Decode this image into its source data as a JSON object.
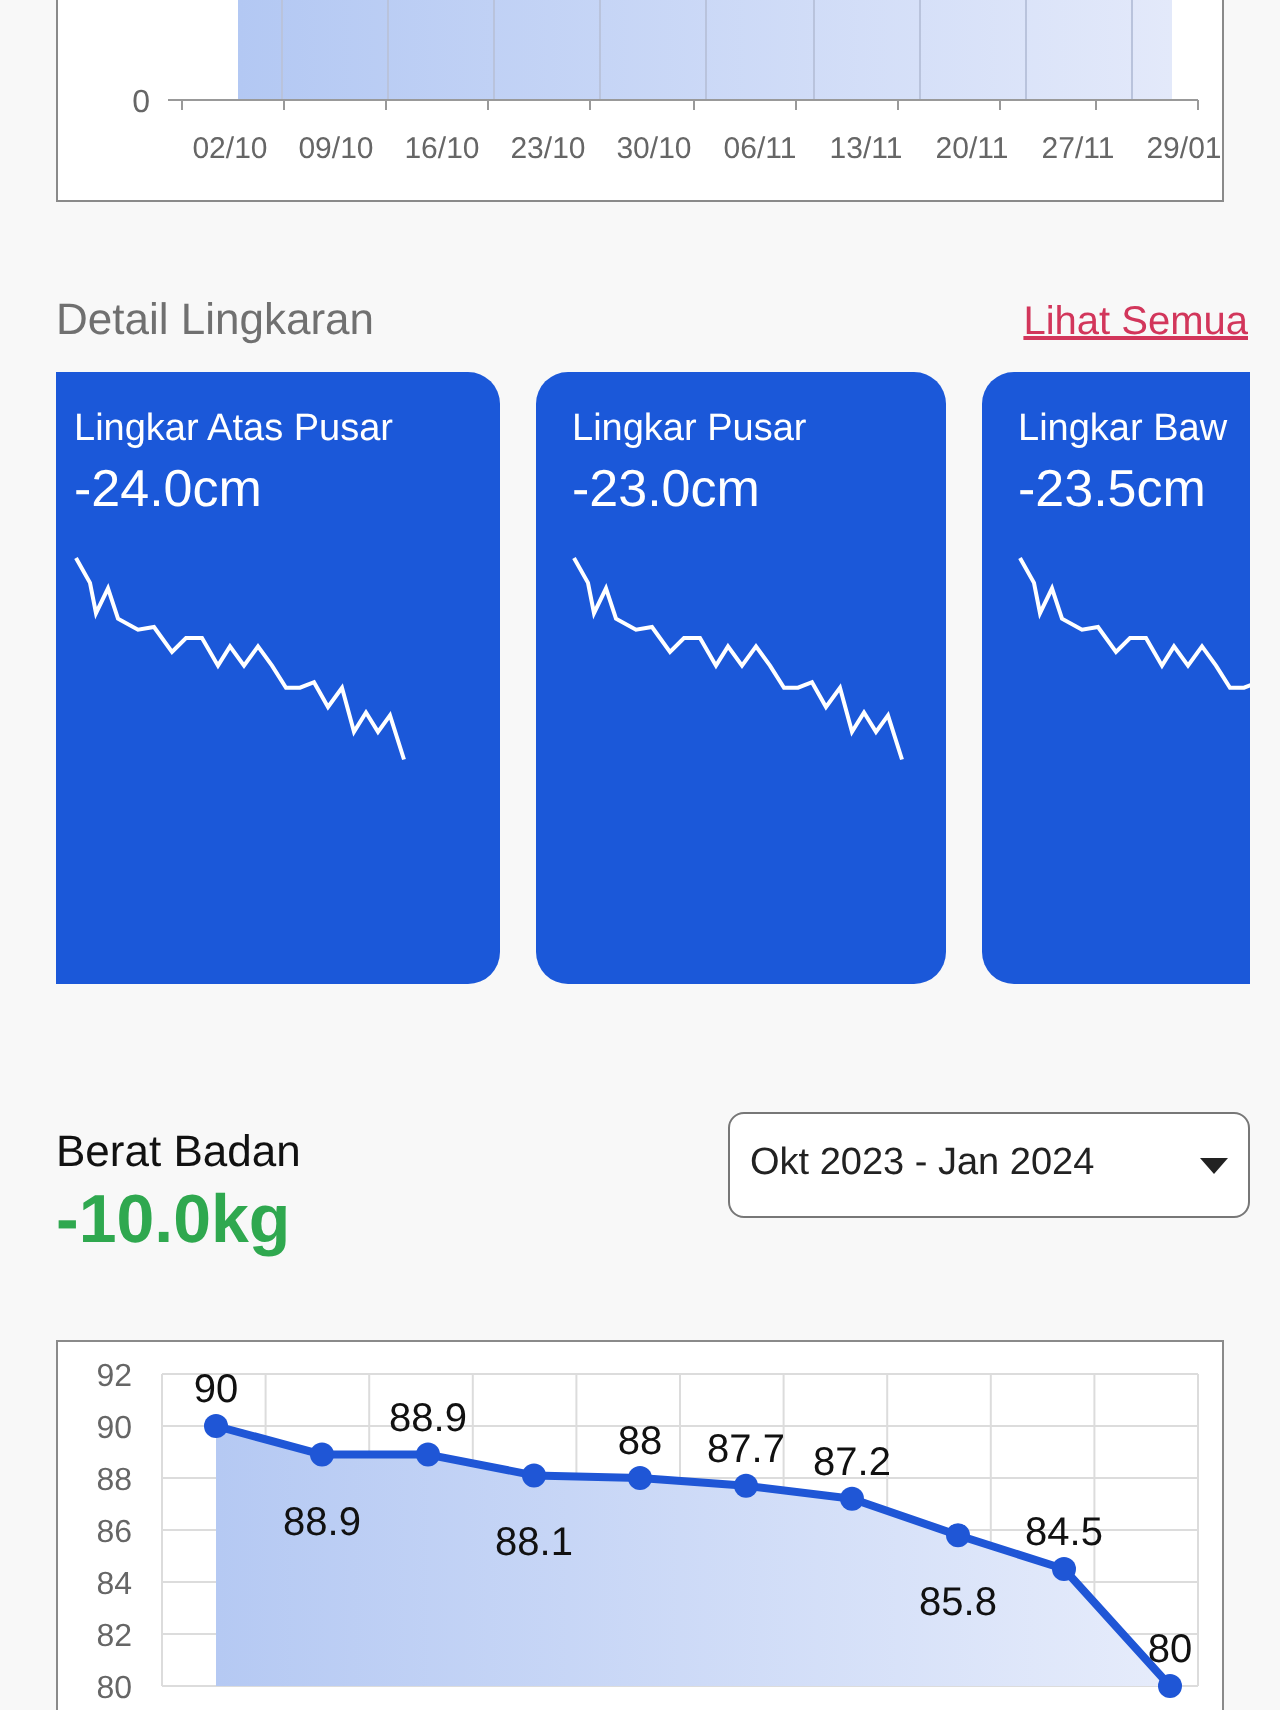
{
  "progress_chart": {
    "y_tick": "0",
    "x_labels": [
      "02/10",
      "09/10",
      "16/10",
      "23/10",
      "30/10",
      "06/11",
      "13/11",
      "20/11",
      "27/11",
      "29/01"
    ]
  },
  "circumference": {
    "title": "Detail Lingkaran",
    "link": "Lihat Semua",
    "cards": [
      {
        "label": "Lingkar Atas Pusar",
        "value": "-24.0cm"
      },
      {
        "label": "Lingkar Pusar",
        "value": "-23.0cm"
      },
      {
        "label": "Lingkar Baw",
        "value": "-23.5cm"
      }
    ]
  },
  "weight": {
    "title": "Berat Badan",
    "change": "-10.0kg",
    "period": "Okt 2023 - Jan 2024",
    "chart_data": {
      "type": "area",
      "series": [
        {
          "color": "#1f56d6",
          "values": [
            90,
            88.9,
            88.9,
            88.1,
            88,
            87.7,
            87.2,
            85.8,
            84.5,
            80
          ]
        }
      ],
      "ylim": [
        80,
        92
      ],
      "yticks": [
        80,
        82,
        84,
        86,
        88,
        90,
        92
      ],
      "data_labels": true,
      "grid": true
    }
  }
}
